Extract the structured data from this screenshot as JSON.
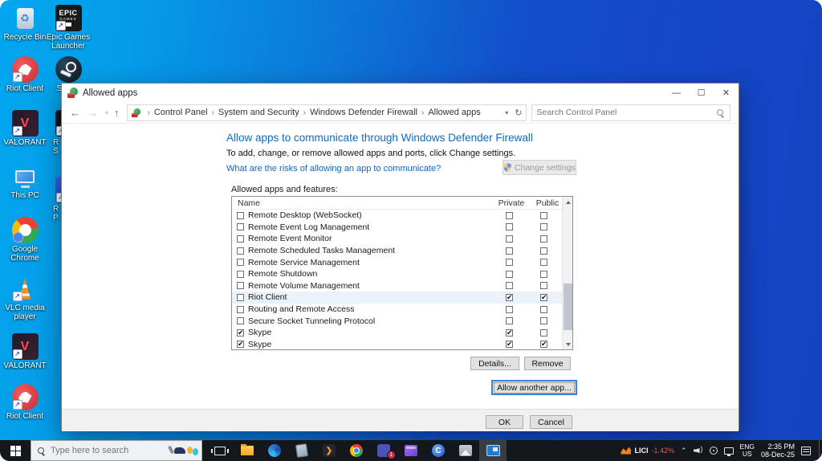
{
  "desktop": {
    "icons": [
      {
        "type": "recycle",
        "name": "recycle-bin",
        "label": "Recycle Bin",
        "shortcut": false
      },
      {
        "type": "epic",
        "name": "epic-games-launcher",
        "label": "Epic Games Launcher",
        "shortcut": true
      },
      {
        "type": "riot",
        "name": "riot-client",
        "label": "Riot Client",
        "shortcut": true
      },
      {
        "type": "steam",
        "name": "steam",
        "label": "Steam",
        "shortcut": true
      },
      {
        "type": "valorant",
        "name": "valorant",
        "label": "VALORANT",
        "shortcut": true
      },
      {
        "type": "hblack",
        "name": "partially-hidden-icon",
        "label": "R\nS",
        "shortcut": true,
        "leftlabel": true
      },
      {
        "type": "thispc",
        "name": "this-pc",
        "label": "This PC",
        "shortcut": false
      },
      {
        "type": "hblue",
        "name": "partially-hidden-icon-2",
        "label": "R\nP",
        "shortcut": true,
        "leftlabel": true
      },
      {
        "type": "chrome",
        "name": "google-chrome",
        "label": "Google Chrome",
        "shortcut": true
      },
      {
        "type": "vlc",
        "name": "vlc-media-player",
        "label": "VLC media player",
        "shortcut": true
      },
      {
        "type": "valorant",
        "name": "valorant-2",
        "label": "VALORANT",
        "shortcut": true
      },
      {
        "type": "riot",
        "name": "riot-client-2",
        "label": "Riot Client",
        "shortcut": true
      }
    ]
  },
  "window": {
    "title": "Allowed apps",
    "breadcrumb": [
      "Control Panel",
      "System and Security",
      "Windows Defender Firewall",
      "Allowed apps"
    ],
    "search_placeholder": "Search Control Panel",
    "heading": "Allow apps to communicate through Windows Defender Firewall",
    "subheading": "To add, change, or remove allowed apps and ports, click Change settings.",
    "risk_link": "What are the risks of allowing an app to communicate?",
    "change_settings_label": "Change settings",
    "list_label": "Allowed apps and features:",
    "columns": {
      "name": "Name",
      "private": "Private",
      "public": "Public"
    },
    "rows": [
      {
        "name": "Remote Desktop (WebSocket)",
        "app": false,
        "private": false,
        "public": false,
        "selected": false
      },
      {
        "name": "Remote Event Log Management",
        "app": false,
        "private": false,
        "public": false,
        "selected": false
      },
      {
        "name": "Remote Event Monitor",
        "app": false,
        "private": false,
        "public": false,
        "selected": false
      },
      {
        "name": "Remote Scheduled Tasks Management",
        "app": false,
        "private": false,
        "public": false,
        "selected": false
      },
      {
        "name": "Remote Service Management",
        "app": false,
        "private": false,
        "public": false,
        "selected": false
      },
      {
        "name": "Remote Shutdown",
        "app": false,
        "private": false,
        "public": false,
        "selected": false
      },
      {
        "name": "Remote Volume Management",
        "app": false,
        "private": false,
        "public": false,
        "selected": false
      },
      {
        "name": "Riot Client",
        "app": false,
        "private": true,
        "public": true,
        "selected": true
      },
      {
        "name": "Routing and Remote Access",
        "app": false,
        "private": false,
        "public": false,
        "selected": false
      },
      {
        "name": "Secure Socket Tunneling Protocol",
        "app": false,
        "private": false,
        "public": false,
        "selected": false
      },
      {
        "name": "Skype",
        "app": true,
        "private": true,
        "public": false,
        "selected": false
      },
      {
        "name": "Skype",
        "app": true,
        "private": true,
        "public": true,
        "selected": false
      }
    ],
    "details_label": "Details...",
    "remove_label": "Remove",
    "allow_another_label": "Allow another app...",
    "ok_label": "OK",
    "cancel_label": "Cancel"
  },
  "taskbar": {
    "search_placeholder": "Type here to search",
    "apps": [
      {
        "type": "tv",
        "name": "task-view-button"
      },
      {
        "type": "fold",
        "name": "file-explorer"
      },
      {
        "type": "edgeic",
        "name": "edge-browser"
      },
      {
        "type": "tabletic",
        "name": "tablet-app"
      },
      {
        "type": "termic",
        "name": "terminal-app",
        "glyph": "❯"
      },
      {
        "type": "chromeic",
        "name": "chrome-browser"
      },
      {
        "type": "teamsic",
        "name": "teams-app",
        "badge": "1"
      },
      {
        "type": "filmsic",
        "name": "films-app"
      },
      {
        "type": "cic",
        "name": "c-app",
        "glyph": "C"
      },
      {
        "type": "photic",
        "name": "photos-app"
      },
      {
        "type": "cplic",
        "name": "control-panel-window",
        "active": true
      }
    ],
    "tray": {
      "ticker_symbol": "LICI",
      "ticker_change": "-1.42%",
      "language": "ENG",
      "region": "US",
      "time": "2:35 PM",
      "date": "08-Dec-25"
    }
  }
}
